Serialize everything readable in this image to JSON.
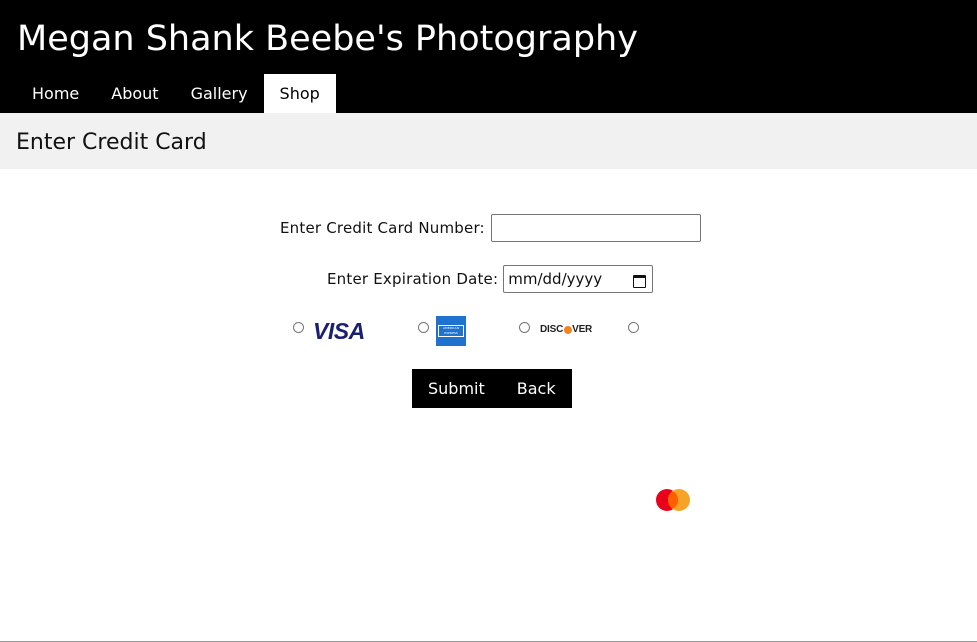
{
  "site": {
    "title": "Megan Shank Beebe's Photography"
  },
  "nav": {
    "items": [
      {
        "label": "Home"
      },
      {
        "label": "About"
      },
      {
        "label": "Gallery"
      },
      {
        "label": "Shop"
      }
    ],
    "active": "Shop"
  },
  "page": {
    "title": "Enter Credit Card"
  },
  "form": {
    "card_number_label": "Enter Credit Card Number:",
    "card_number_value": "",
    "expiration_label": "Enter Expiration Date:",
    "expiration_placeholder": "mm/dd/yyyy",
    "card_types": [
      {
        "icon": "visa-logo",
        "label": "VISA",
        "selected": false
      },
      {
        "icon": "amex-logo",
        "label": "AMERICAN EXPRESS",
        "selected": false
      },
      {
        "icon": "discover-logo",
        "label": "DISCOVER",
        "selected": false
      },
      {
        "icon": "mastercard-logo",
        "label": "",
        "selected": false
      }
    ],
    "submit_label": "Submit",
    "back_label": "Back"
  },
  "colors": {
    "header_bg": "#000000",
    "subheader_bg": "#f1f1f1",
    "button_bg": "#000000"
  }
}
